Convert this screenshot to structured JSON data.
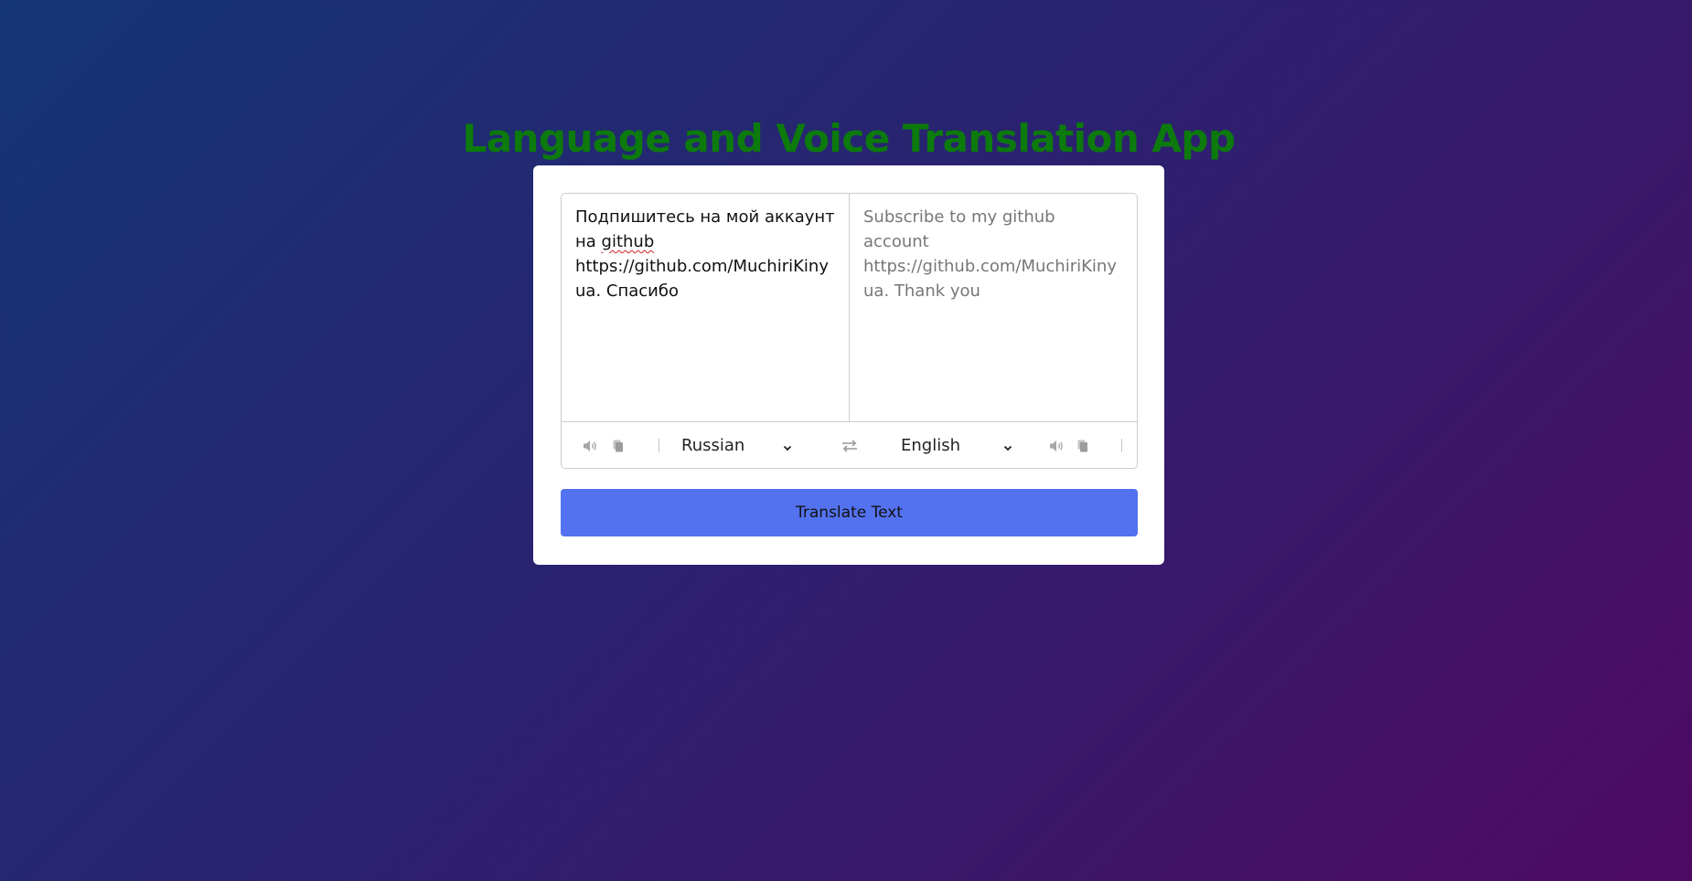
{
  "app": {
    "title": "Language and Voice Translation App"
  },
  "translator": {
    "from_text_before": "Подпишитесь на мой аккаунт на ",
    "from_text_misspelled": "github",
    "from_text_after": " https://github.com/MuchiriKinyua. Спасибо",
    "to_text": "Subscribe to my github account https://github.com/MuchiriKinyua. Thank you",
    "from_language": "Russian",
    "to_language": "English",
    "translate_button_label": "Translate Text"
  },
  "icons": {
    "from_speak": "volume-icon",
    "from_copy": "copy-icon",
    "swap": "exchange-icon",
    "to_speak": "volume-icon",
    "to_copy": "copy-icon",
    "dropdown": "chevron-down-icon"
  },
  "colors": {
    "title": "#0c7a0c",
    "button": "#5372f0",
    "card": "#ffffff",
    "background_start": "#153675",
    "background_end": "#4f0a63"
  }
}
